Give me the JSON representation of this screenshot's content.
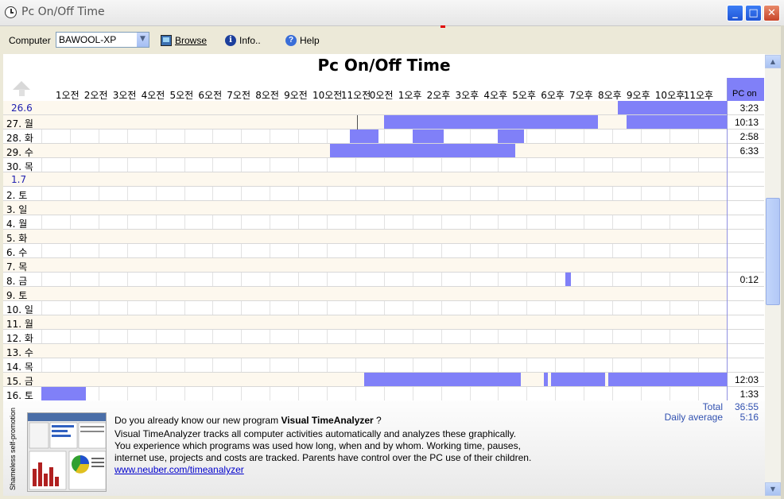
{
  "window": {
    "title": "Pc On/Off Time",
    "buttons": {
      "minimize": "_",
      "maximize": "□",
      "close": "✕"
    }
  },
  "toolbar": {
    "computer_label": "Computer",
    "computer_value": "BAWOOL-XP",
    "browse_label": "Browse",
    "info_label": "Info..",
    "help_label": "Help"
  },
  "report": {
    "heading": "Pc On/Off Time",
    "pc_on_header": "PC on",
    "hours": [
      "1오전",
      "2오전",
      "3오전",
      "4오전",
      "5오전",
      "6오전",
      "7오전",
      "8오전",
      "9오전",
      "10오전",
      "11오전",
      "0오전",
      "1오후",
      "2오후",
      "3오후",
      "4오후",
      "5오후",
      "6오후",
      "7오후",
      "8오후",
      "9오후",
      "10오후",
      "11오후"
    ],
    "rows": [
      {
        "date": "26.6",
        "month_start": true,
        "pc_on": "3:23",
        "sessions": [
          [
            20.2,
            24
          ]
        ]
      },
      {
        "date": "27. 월",
        "pc_on": "10:13",
        "sessions": [
          [
            12,
            19.5
          ],
          [
            20.5,
            24
          ]
        ],
        "ticks": [
          11.05
        ]
      },
      {
        "date": "28. 화",
        "pc_on": "2:58",
        "sessions": [
          [
            10.8,
            11.8
          ],
          [
            13,
            14.1
          ],
          [
            16,
            16.9
          ]
        ]
      },
      {
        "date": "29. 수",
        "pc_on": "6:33",
        "sessions": [
          [
            10.1,
            16.6
          ]
        ]
      },
      {
        "date": "30. 목",
        "pc_on": "",
        "sessions": []
      },
      {
        "date": "1.7",
        "month_start": true,
        "pc_on": "",
        "sessions": []
      },
      {
        "date": "2. 토",
        "pc_on": "",
        "sessions": []
      },
      {
        "date": "3. 일",
        "pc_on": "",
        "sessions": []
      },
      {
        "date": "4. 월",
        "pc_on": "",
        "sessions": []
      },
      {
        "date": "5. 화",
        "pc_on": "",
        "sessions": []
      },
      {
        "date": "6. 수",
        "pc_on": "",
        "sessions": []
      },
      {
        "date": "7. 목",
        "pc_on": "",
        "sessions": []
      },
      {
        "date": "8. 금",
        "pc_on": "0:12",
        "sessions": [
          [
            18.35,
            18.55
          ]
        ]
      },
      {
        "date": "9. 토",
        "pc_on": "",
        "sessions": []
      },
      {
        "date": "10. 일",
        "pc_on": "",
        "sessions": []
      },
      {
        "date": "11. 월",
        "pc_on": "",
        "sessions": []
      },
      {
        "date": "12. 화",
        "pc_on": "",
        "sessions": []
      },
      {
        "date": "13. 수",
        "pc_on": "",
        "sessions": []
      },
      {
        "date": "14. 목",
        "pc_on": "",
        "sessions": []
      },
      {
        "date": "15. 금",
        "pc_on": "12:03",
        "sessions": [
          [
            11.3,
            16.8
          ],
          [
            17.6,
            17.75
          ],
          [
            17.85,
            19.75
          ],
          [
            19.85,
            24
          ]
        ]
      },
      {
        "date": "16. 토",
        "pc_on": "1:33",
        "sessions": [
          [
            0,
            1.55
          ]
        ]
      }
    ],
    "total_label": "Total",
    "total_value": "36:55",
    "avg_label": "Daily average",
    "avg_value": "5:16",
    "bar_color": "#8080f8"
  },
  "promo": {
    "side_label": "Shameless self-promotion",
    "line1_prefix": "Do you already know our new program ",
    "line1_product": "Visual TimeAnalyzer",
    "line1_suffix": " ?",
    "line2": "Visual TimeAnalyzer tracks all computer activities automatically and analyzes these graphically.",
    "line3": "You experience which programs was used how long, when and by whom. Working time, pauses,",
    "line4": "internet use, projects and costs are tracked. Parents have control over the PC use of their children.",
    "link": "www.neuber.com/timeanalyzer"
  }
}
